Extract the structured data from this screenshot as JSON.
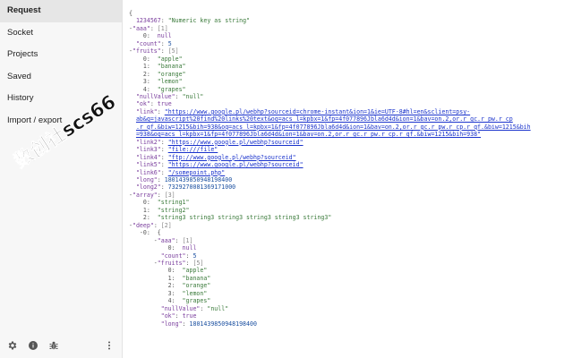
{
  "sidebar": {
    "items": [
      {
        "label": "Request",
        "active": true
      },
      {
        "label": "Socket"
      },
      {
        "label": "Projects"
      },
      {
        "label": "Saved"
      },
      {
        "label": "History"
      },
      {
        "label": "Import / export"
      }
    ],
    "bottom_icons": [
      "gear-icon",
      "info-icon",
      "bug-icon",
      "more-vert-icon"
    ]
  },
  "watermark": {
    "text": "数创社scs66"
  },
  "json_lines": [
    [
      [
        "x",
        "{"
      ]
    ],
    [
      [
        "x",
        "  "
      ],
      [
        "k",
        "1234567"
      ],
      [
        "x",
        ": "
      ],
      [
        "s",
        "\"Numeric key as string\""
      ]
    ],
    [
      [
        "x",
        "-"
      ],
      [
        "k",
        "\"aaa\""
      ],
      [
        "x",
        ": "
      ],
      [
        "c",
        "[1]"
      ]
    ],
    [
      [
        "x",
        "    0:  "
      ],
      [
        "b",
        "null"
      ]
    ],
    [
      [
        "x",
        "  "
      ],
      [
        "k",
        "\"count\""
      ],
      [
        "x",
        ": "
      ],
      [
        "n",
        "5"
      ]
    ],
    [
      [
        "x",
        "-"
      ],
      [
        "k",
        "\"fruits\""
      ],
      [
        "x",
        ": "
      ],
      [
        "c",
        "[5]"
      ]
    ],
    [
      [
        "x",
        "    0:  "
      ],
      [
        "s",
        "\"apple\""
      ]
    ],
    [
      [
        "x",
        "    1:  "
      ],
      [
        "s",
        "\"banana\""
      ]
    ],
    [
      [
        "x",
        "    2:  "
      ],
      [
        "s",
        "\"orange\""
      ]
    ],
    [
      [
        "x",
        "    3:  "
      ],
      [
        "s",
        "\"lemon\""
      ]
    ],
    [
      [
        "x",
        "    4:  "
      ],
      [
        "s",
        "\"grapes\""
      ]
    ],
    [
      [
        "x",
        "  "
      ],
      [
        "k",
        "\"nullValue\""
      ],
      [
        "x",
        ": "
      ],
      [
        "s",
        "\"null\""
      ]
    ],
    [
      [
        "x",
        "  "
      ],
      [
        "k",
        "\"ok\""
      ],
      [
        "x",
        ": "
      ],
      [
        "b",
        "true"
      ]
    ],
    [
      [
        "x",
        "  "
      ],
      [
        "k",
        "\"link\""
      ],
      [
        "x",
        ": "
      ],
      [
        "lnk",
        "\"https://www.google.pl/webhp?sourceid=chrome-instant&ion=1&ie=UTF-8#hl=en&sclient=psy-"
      ]
    ],
    [
      [
        "x",
        "  "
      ],
      [
        "lnk",
        "ab&q=javascript%20find%20links%20text&oq=acs_l=kpbx=1&fp=4f077896Jbla6d4d&ion=1&bav=on.2,or.r_gc.r_pw.r_cp"
      ]
    ],
    [
      [
        "x",
        "  "
      ],
      [
        "lnk",
        ".r_qf.&biw=1215&bih=938&oq=acs_l=kpbx=1&fp=4f077896Jbla6d4d&ion=1&bav=on.2,or.r_gc.r_pw.r_cp.r_qf.&biw=1215&bih"
      ]
    ],
    [
      [
        "x",
        "  "
      ],
      [
        "lnk",
        "=938&oq=acs_l=kpbx=1&fp=4f077896Jbla6d4d&ion=1&bav=on.2,or.r_gc.r_pw.r_cp.r_qf.&biw=1215&bih=938\""
      ]
    ],
    [
      [
        "x",
        "  "
      ],
      [
        "k",
        "\"link2\""
      ],
      [
        "x",
        ": "
      ],
      [
        "lnk",
        "\"https://www.google.pl/webhp?sourceid\""
      ]
    ],
    [
      [
        "x",
        "  "
      ],
      [
        "k",
        "\"link3\""
      ],
      [
        "x",
        ": "
      ],
      [
        "lnk",
        "\"file:///file\""
      ]
    ],
    [
      [
        "x",
        "  "
      ],
      [
        "k",
        "\"link4\""
      ],
      [
        "x",
        ": "
      ],
      [
        "lnk",
        "\"ftp://www.google.pl/webhp?sourceid\""
      ]
    ],
    [
      [
        "x",
        "  "
      ],
      [
        "k",
        "\"link5\""
      ],
      [
        "x",
        ": "
      ],
      [
        "lnk",
        "\"https://www.google.pl/webhp?sourceid\""
      ]
    ],
    [
      [
        "x",
        "  "
      ],
      [
        "k",
        "\"link6\""
      ],
      [
        "x",
        ": "
      ],
      [
        "lnk",
        "\"/somepoint.php\""
      ]
    ],
    [
      [
        "x",
        "  "
      ],
      [
        "k",
        "\"long\""
      ],
      [
        "x",
        ": "
      ],
      [
        "n",
        "1801439850948198400"
      ]
    ],
    [
      [
        "x",
        "  "
      ],
      [
        "k",
        "\"long2\""
      ],
      [
        "x",
        ": "
      ],
      [
        "n",
        "7329270081369171000"
      ]
    ],
    [
      [
        "x",
        "-"
      ],
      [
        "k",
        "\"array\""
      ],
      [
        "x",
        ": "
      ],
      [
        "c",
        "[3]"
      ]
    ],
    [
      [
        "x",
        "    0:  "
      ],
      [
        "s",
        "\"string1\""
      ]
    ],
    [
      [
        "x",
        "    1:  "
      ],
      [
        "s",
        "\"string2\""
      ]
    ],
    [
      [
        "x",
        "    2:  "
      ],
      [
        "s",
        "\"string3 string3 string3 string3 string3 string3\""
      ]
    ],
    [
      [
        "x",
        "-"
      ],
      [
        "k",
        "\"deep\""
      ],
      [
        "x",
        ": "
      ],
      [
        "c",
        "[2]"
      ]
    ],
    [
      [
        "x",
        "   -0:  {"
      ]
    ],
    [
      [
        "x",
        "       -"
      ],
      [
        "k",
        "\"aaa\""
      ],
      [
        "x",
        ": "
      ],
      [
        "c",
        "[1]"
      ]
    ],
    [
      [
        "x",
        "           0:  "
      ],
      [
        "b",
        "null"
      ]
    ],
    [
      [
        "x",
        "         "
      ],
      [
        "k",
        "\"count\""
      ],
      [
        "x",
        ": "
      ],
      [
        "n",
        "5"
      ]
    ],
    [
      [
        "x",
        "       -"
      ],
      [
        "k",
        "\"fruits\""
      ],
      [
        "x",
        ": "
      ],
      [
        "c",
        "[5]"
      ]
    ],
    [
      [
        "x",
        "           0:  "
      ],
      [
        "s",
        "\"apple\""
      ]
    ],
    [
      [
        "x",
        "           1:  "
      ],
      [
        "s",
        "\"banana\""
      ]
    ],
    [
      [
        "x",
        "           2:  "
      ],
      [
        "s",
        "\"orange\""
      ]
    ],
    [
      [
        "x",
        "           3:  "
      ],
      [
        "s",
        "\"lemon\""
      ]
    ],
    [
      [
        "x",
        "           4:  "
      ],
      [
        "s",
        "\"grapes\""
      ]
    ],
    [
      [
        "x",
        "         "
      ],
      [
        "k",
        "\"nullValue\""
      ],
      [
        "x",
        ": "
      ],
      [
        "s",
        "\"null\""
      ]
    ],
    [
      [
        "x",
        "         "
      ],
      [
        "k",
        "\"ok\""
      ],
      [
        "x",
        ": "
      ],
      [
        "b",
        "true"
      ]
    ],
    [
      [
        "x",
        "         "
      ],
      [
        "k",
        "\"long\""
      ],
      [
        "x",
        ": "
      ],
      [
        "n",
        "1801439850948198400"
      ]
    ]
  ]
}
